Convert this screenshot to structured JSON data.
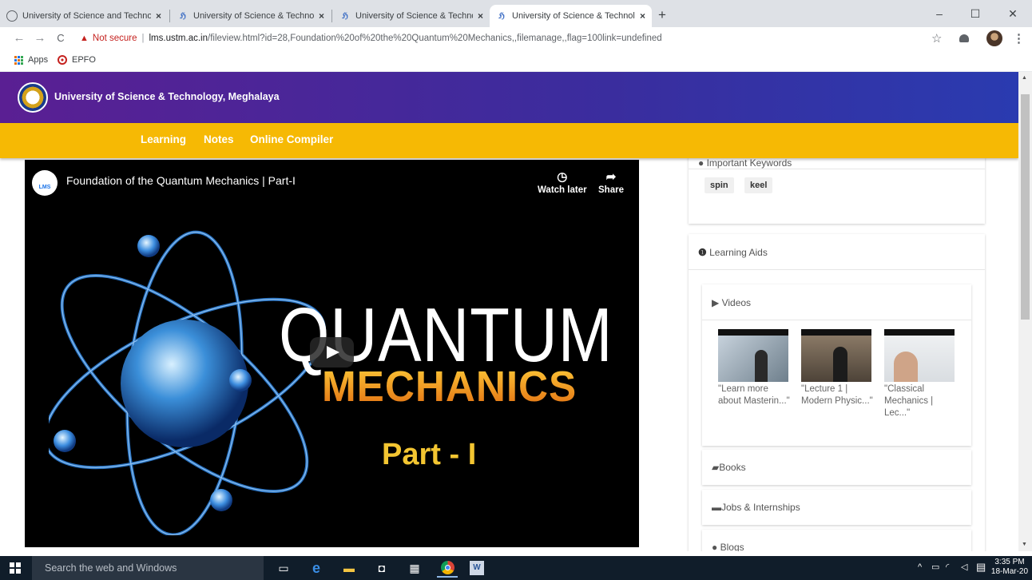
{
  "browser": {
    "tabs": [
      {
        "title": "University of Science and Techno",
        "favicon": "globe-icon",
        "close": "×"
      },
      {
        "title": "University of Science & Technolo",
        "favicon": "lms-icon",
        "close": "×"
      },
      {
        "title": "University of Science & Technolo",
        "favicon": "lms-icon",
        "close": "×"
      },
      {
        "title": "University of Science & Technolo",
        "favicon": "lms-icon",
        "close": "×"
      }
    ],
    "new_tab": "+",
    "window_controls": {
      "minimize": "–",
      "maximize": "☐",
      "close": "✕"
    },
    "address": {
      "security_icon": "▲",
      "security_label": "Not secure",
      "separator": "|",
      "host": "lms.ustm.ac.in",
      "path": "/fileview.html?id=28,Foundation%20of%20the%20Quantum%20Mechanics,,filemanage,,flag=100link=undefined"
    },
    "nav": {
      "back": "←",
      "forward": "→",
      "reload": "C"
    },
    "toolbar_icons": {
      "star": "☆",
      "menu": "⋮"
    },
    "bookmarks": [
      {
        "label": "Apps",
        "icon": "apps-grid-icon"
      },
      {
        "label": "EPFO",
        "icon": "epfo-icon"
      }
    ]
  },
  "site": {
    "name": "University of Science & Technology, Meghalaya",
    "nav": [
      "Learning",
      "Notes",
      "Online Compiler"
    ]
  },
  "video": {
    "title": "Foundation of the Quantum Mechanics | Part-I",
    "channel_logo_text": "LMS",
    "actions": [
      {
        "label": "Watch later",
        "icon": "clock-icon"
      },
      {
        "label": "Share",
        "icon": "share-arrow-icon"
      }
    ],
    "thumbnail_text": {
      "line1": "QUANTUM",
      "line2": "MECHANICS",
      "line3": "Part - I"
    }
  },
  "sidebar": {
    "keywords": {
      "heading": "Important Keywords",
      "tags": [
        "spin",
        "keel"
      ]
    },
    "learning_aids": {
      "heading": "Learning Aids",
      "videos_heading": "Videos",
      "videos": [
        {
          "caption": "\"Learn more about Masterin...\""
        },
        {
          "caption": "\"Lecture 1 | Modern Physic...\""
        },
        {
          "caption": "\"Classical Mechanics | Lec...\""
        }
      ],
      "sections": [
        "Books",
        "Jobs & Internships",
        "Blogs"
      ]
    }
  },
  "taskbar": {
    "search_placeholder": "Search the web and Windows",
    "time": "3:35 PM",
    "date": "18-Mar-20",
    "tray_icon": "^"
  }
}
